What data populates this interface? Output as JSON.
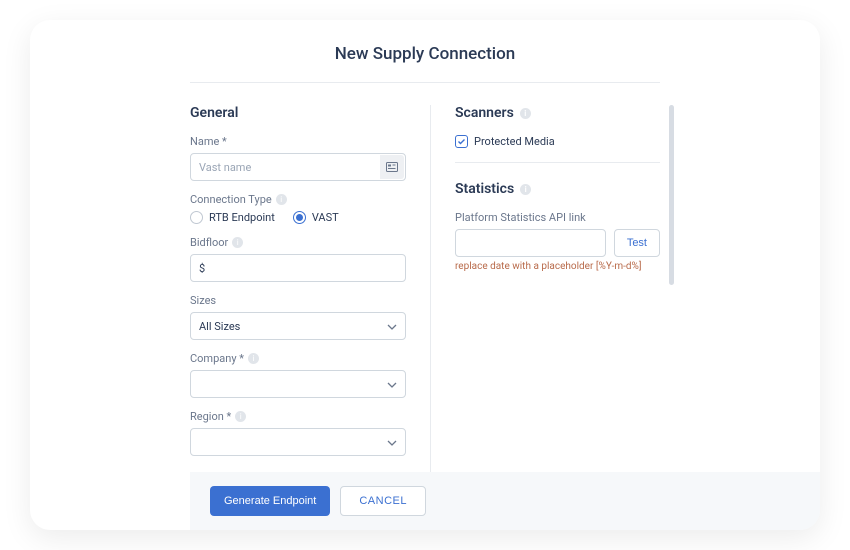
{
  "title": "New Supply Connection",
  "general": {
    "header": "General",
    "name_label": "Name *",
    "name_placeholder": "Vast name",
    "connection_type_label": "Connection Type",
    "connection_options": {
      "rtb": "RTB Endpoint",
      "vast": "VAST"
    },
    "connection_selected": "vast",
    "bidfloor_label": "Bidfloor",
    "bidfloor_value": "$",
    "sizes_label": "Sizes",
    "sizes_value": "All Sizes",
    "company_label": "Company *",
    "company_value": "",
    "region_label": "Region *",
    "region_value": ""
  },
  "scanners": {
    "header": "Scanners",
    "protected_media_label": "Protected Media",
    "protected_media_checked": true
  },
  "statistics": {
    "header": "Statistics",
    "api_link_label": "Platform Statistics API link",
    "api_link_value": "",
    "test_label": "Test",
    "hint": "replace date with a placeholder [%Y-m-d%]"
  },
  "footer": {
    "generate_label": "Generate Endpoint",
    "cancel_label": "CANCEL"
  }
}
